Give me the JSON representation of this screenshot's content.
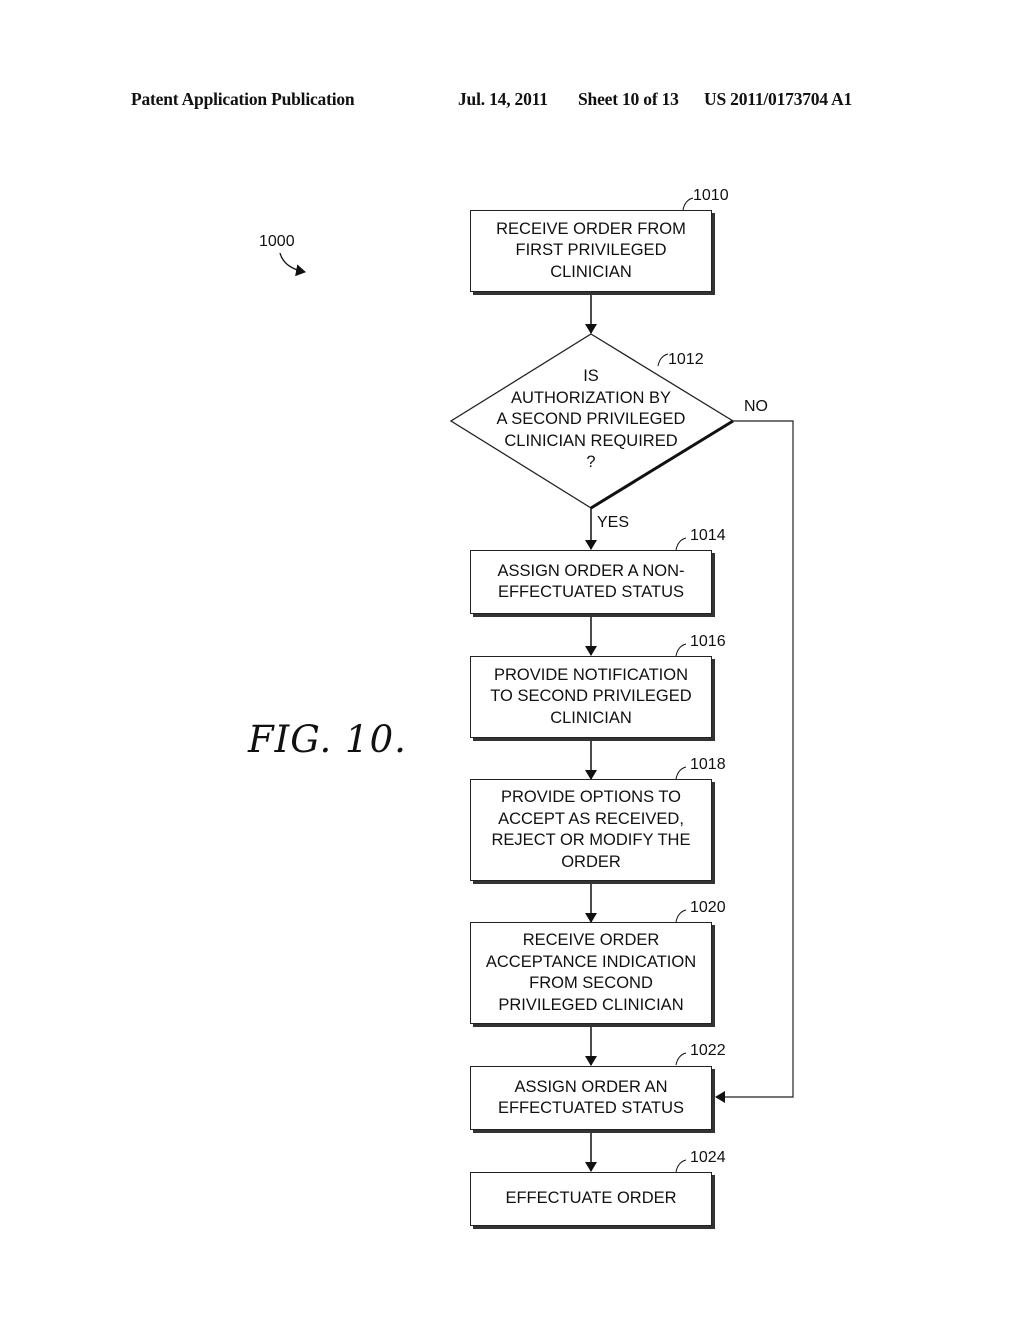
{
  "header": {
    "publication": "Patent Application Publication",
    "date": "Jul. 14, 2011",
    "sheet": "Sheet 10 of 13",
    "number": "US 2011/0173704 A1"
  },
  "figure": {
    "label": "FIG. 10.",
    "ref": "1000"
  },
  "steps": [
    {
      "id": "1010",
      "text": "RECEIVE ORDER FROM\nFIRST PRIVILEGED\nCLINICIAN"
    },
    {
      "id": "1012",
      "text": "IS\nAUTHORIZATION BY\nA SECOND PRIVILEGED\nCLINICIAN REQUIRED\n?",
      "shape": "decision"
    },
    {
      "id": "1014",
      "text": "ASSIGN ORDER A NON-\nEFFECTUATED STATUS"
    },
    {
      "id": "1016",
      "text": "PROVIDE NOTIFICATION\nTO SECOND PRIVILEGED\nCLINICIAN"
    },
    {
      "id": "1018",
      "text": "PROVIDE OPTIONS TO\nACCEPT AS RECEIVED,\nREJECT OR MODIFY THE\nORDER"
    },
    {
      "id": "1020",
      "text": "RECEIVE ORDER\nACCEPTANCE INDICATION\nFROM SECOND\nPRIVILEGED CLINICIAN"
    },
    {
      "id": "1022",
      "text": "ASSIGN ORDER AN\nEFFECTUATED STATUS"
    },
    {
      "id": "1024",
      "text": "EFFECTUATE ORDER"
    }
  ],
  "branches": {
    "yes": "YES",
    "no": "NO"
  }
}
